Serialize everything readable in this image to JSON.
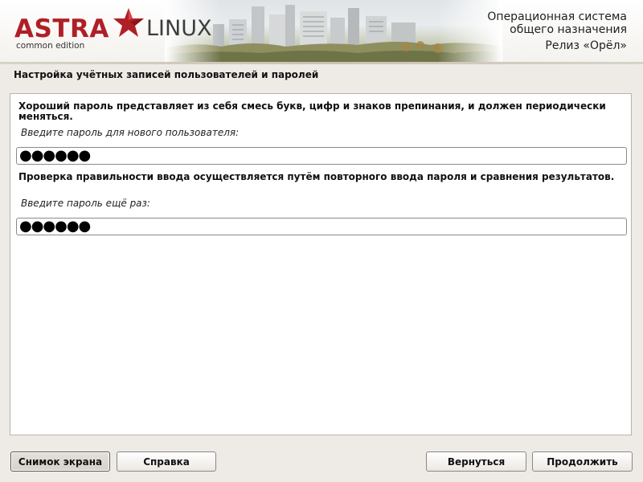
{
  "header": {
    "logo_astra": "ASTRA",
    "logo_linux": "LINUX",
    "logo_edition": "common edition",
    "os_line1": "Операционная система",
    "os_line2": "общего назначения",
    "release": "Релиз «Орёл»"
  },
  "title": "Настройка учётных записей пользователей и паролей",
  "content": {
    "desc1": "Хороший пароль представляет из себя смесь букв, цифр и знаков препинания, и должен периодически меняться.",
    "prompt1": "Введите пароль для нового пользователя:",
    "password1_value": "●●●●●●",
    "desc2": "Проверка правильности ввода осуществляется путём повторного ввода пароля и сравнения результатов.",
    "prompt2": "Введите пароль ещё раз:",
    "password2_value": "●●●●●●"
  },
  "buttons": {
    "screenshot": "Снимок экрана",
    "help": "Справка",
    "back": "Вернуться",
    "continue": "Продолжить"
  },
  "colors": {
    "brand_red": "#b01f26",
    "background": "#eeebe6"
  }
}
